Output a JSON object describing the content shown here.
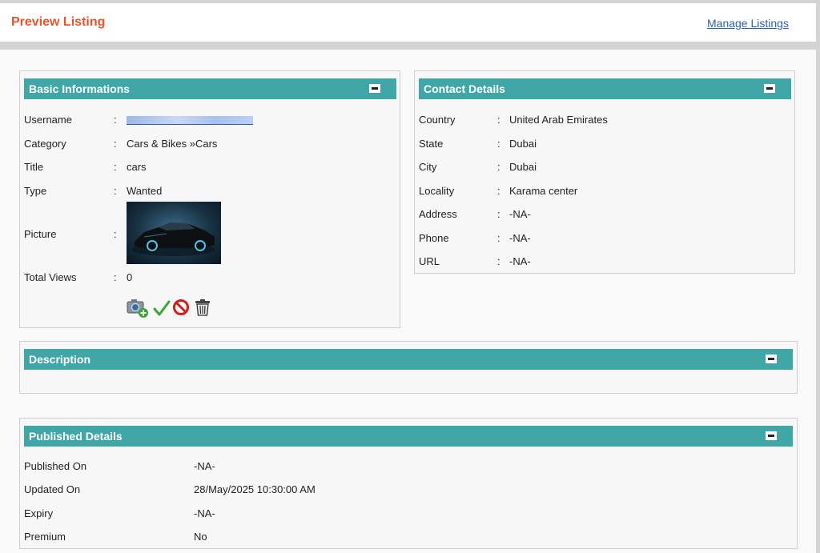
{
  "header": {
    "title": "Preview Listing",
    "manage_link": "Manage Listings"
  },
  "basic": {
    "title": "Basic Informations",
    "fields": [
      {
        "label": "Username",
        "value": ""
      },
      {
        "label": "Category",
        "value": "Cars & Bikes »Cars"
      },
      {
        "label": "Title",
        "value": "cars"
      },
      {
        "label": "Type",
        "value": "Wanted"
      },
      {
        "label": "Picture",
        "value": ""
      },
      {
        "label": "Total Views",
        "value": "0"
      }
    ],
    "actions": [
      "add-photo-icon",
      "approve-check-icon",
      "block-icon",
      "trash-icon"
    ]
  },
  "contact": {
    "title": "Contact Details",
    "fields": [
      {
        "label": "Country",
        "value": "United Arab Emirates"
      },
      {
        "label": "State",
        "value": "Dubai"
      },
      {
        "label": "City",
        "value": "Dubai"
      },
      {
        "label": "Locality",
        "value": "Karama center"
      },
      {
        "label": "Address",
        "value": "-NA-"
      },
      {
        "label": "Phone",
        "value": "-NA-"
      },
      {
        "label": "URL",
        "value": "-NA-"
      }
    ]
  },
  "description": {
    "title": "Description"
  },
  "published": {
    "title": "Published Details",
    "fields": [
      {
        "label": "Published On",
        "value": "-NA-"
      },
      {
        "label": "Updated On",
        "value": "28/May/2025 10:30:00 AM"
      },
      {
        "label": "Expiry",
        "value": "-NA-"
      },
      {
        "label": "Premium",
        "value": "No"
      }
    ]
  },
  "colon": ":",
  "colors": {
    "accent_title": "#e5532b",
    "panel_header": "#41a6a6",
    "link": "#2f5faa"
  }
}
